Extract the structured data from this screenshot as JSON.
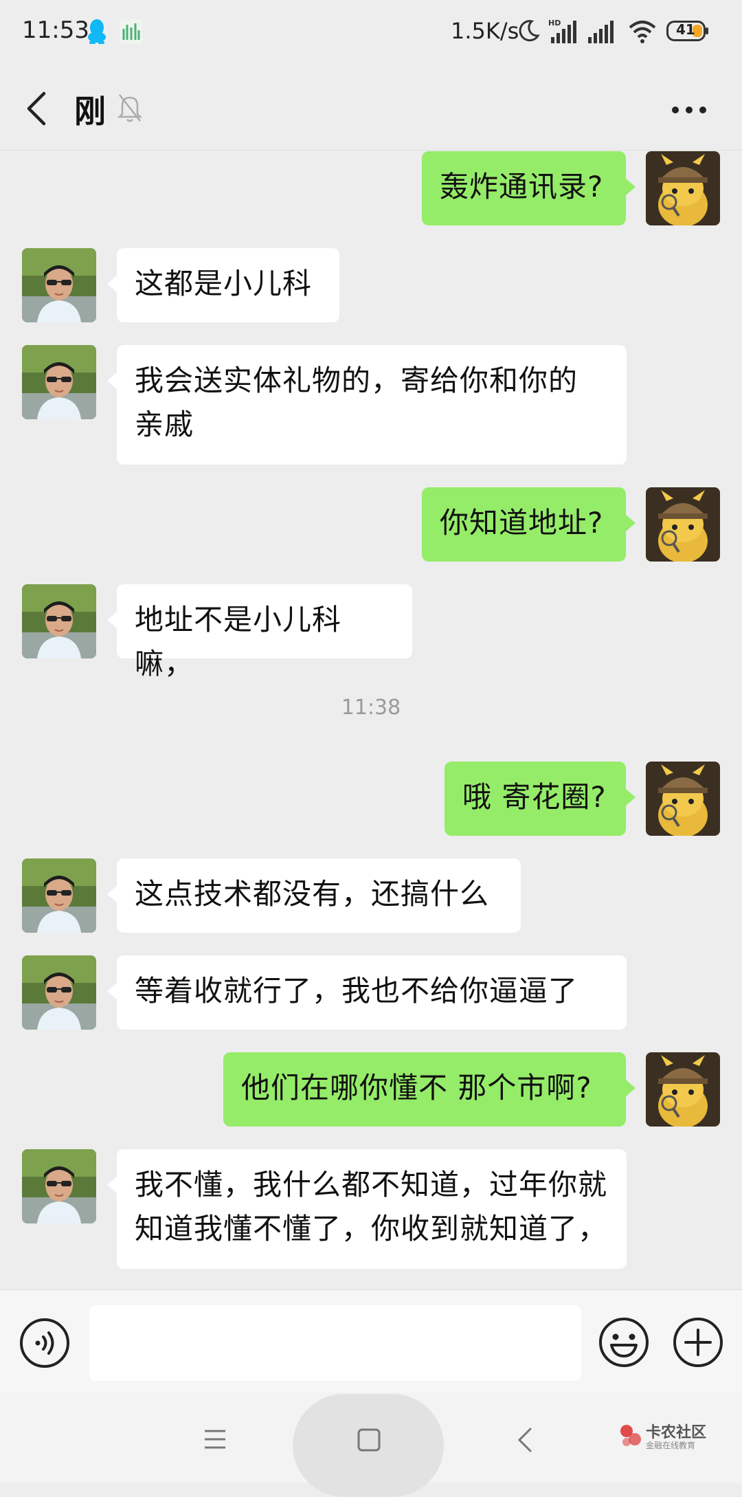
{
  "status_bar": {
    "time": "11:53",
    "net_speed": "1.5K/s",
    "battery": "41",
    "icons": [
      "qq-icon",
      "app-icon",
      "moon-icon",
      "hd-signal-icon",
      "signal-icon",
      "wifi-icon",
      "battery-icon"
    ]
  },
  "header": {
    "title": "刚",
    "icons": [
      "back-icon",
      "mute-bell-icon",
      "more-icon"
    ]
  },
  "messages": [
    {
      "side": "self",
      "text": "轰炸通讯录?"
    },
    {
      "side": "peer",
      "text": "这都是小儿科"
    },
    {
      "side": "peer",
      "text": "我会送实体礼物的，寄给你和你的\n亲戚"
    },
    {
      "side": "self",
      "text": "你知道地址?"
    },
    {
      "side": "peer",
      "text": "地址不是小儿科嘛，"
    },
    {
      "type": "time",
      "text": "11:38"
    },
    {
      "side": "self",
      "text": "哦 寄花圈?"
    },
    {
      "side": "peer",
      "text": "这点技术都没有，还搞什么"
    },
    {
      "side": "peer",
      "text": "等着收就行了，我也不给你逼逼了"
    },
    {
      "side": "self",
      "text": "他们在哪你懂不 那个市啊?"
    },
    {
      "side": "peer",
      "text": "我不懂，我什么都不知道，过年你就\n知道我懂不懂了，你收到就知道了，"
    }
  ],
  "input_bar": {
    "text_value": "",
    "icons": [
      "voice-icon",
      "emoji-icon",
      "plus-icon"
    ]
  },
  "nav_bar": {
    "icons": [
      "menu-nav-icon",
      "home-nav-icon",
      "back-nav-icon"
    ],
    "watermark_title": "卡农社区",
    "watermark_sub": "金融在线教育"
  },
  "colors": {
    "self_bubble": "#95ec69",
    "peer_bubble": "#ffffff",
    "background": "#ededed"
  }
}
